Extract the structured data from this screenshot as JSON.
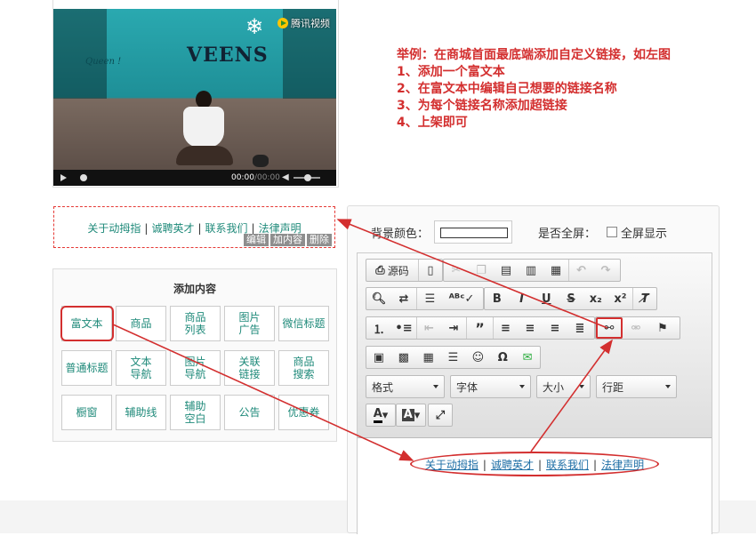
{
  "video": {
    "brand_label": "腾讯视频",
    "wall_sign": "VEENS",
    "wall_script": "Queen !",
    "time_current": "00:00",
    "time_duration": "/00:00"
  },
  "link_widget": {
    "links": [
      "关于动拇指",
      "诚聘英才",
      "联系我们",
      "法律声明"
    ],
    "separator": "|",
    "actions": [
      "编辑",
      "加内容",
      "删除"
    ]
  },
  "add_content": {
    "title": "添加内容",
    "items": [
      "富文本",
      "商品",
      "商品\n列表",
      "图片\n广告",
      "微信标题",
      "普通标题",
      "文本\n导航",
      "图片\n导航",
      "关联\n链接",
      "商品\n搜索",
      "橱窗",
      "辅助线",
      "辅助\n空白",
      "公告",
      "优惠券"
    ]
  },
  "instructions": [
    "举例：在商城首面最底端添加自定义链接，如左图",
    "1、添加一个富文本",
    "2、在富文本中编辑自己想要的链接名称",
    "3、为每个链接名称添加超链接",
    "4、上架即可"
  ],
  "editor_panel": {
    "bg_color_label": "背景颜色：",
    "fullscreen_label": "是否全屏：",
    "fullscreen_option": "全屏显示",
    "fullscreen_checked": false,
    "toolbar": {
      "source_label": "源码",
      "format_select": "格式",
      "font_select": "字体",
      "size_select": "大小",
      "line_height_select": "行距"
    },
    "content_links": [
      "关于动拇指",
      "诚聘英才",
      "联系我们",
      "法律声明"
    ]
  },
  "colors": {
    "annotation_red": "#d32f2f",
    "link_teal": "#1f8a7a",
    "link_blue": "#1f6fa6"
  }
}
